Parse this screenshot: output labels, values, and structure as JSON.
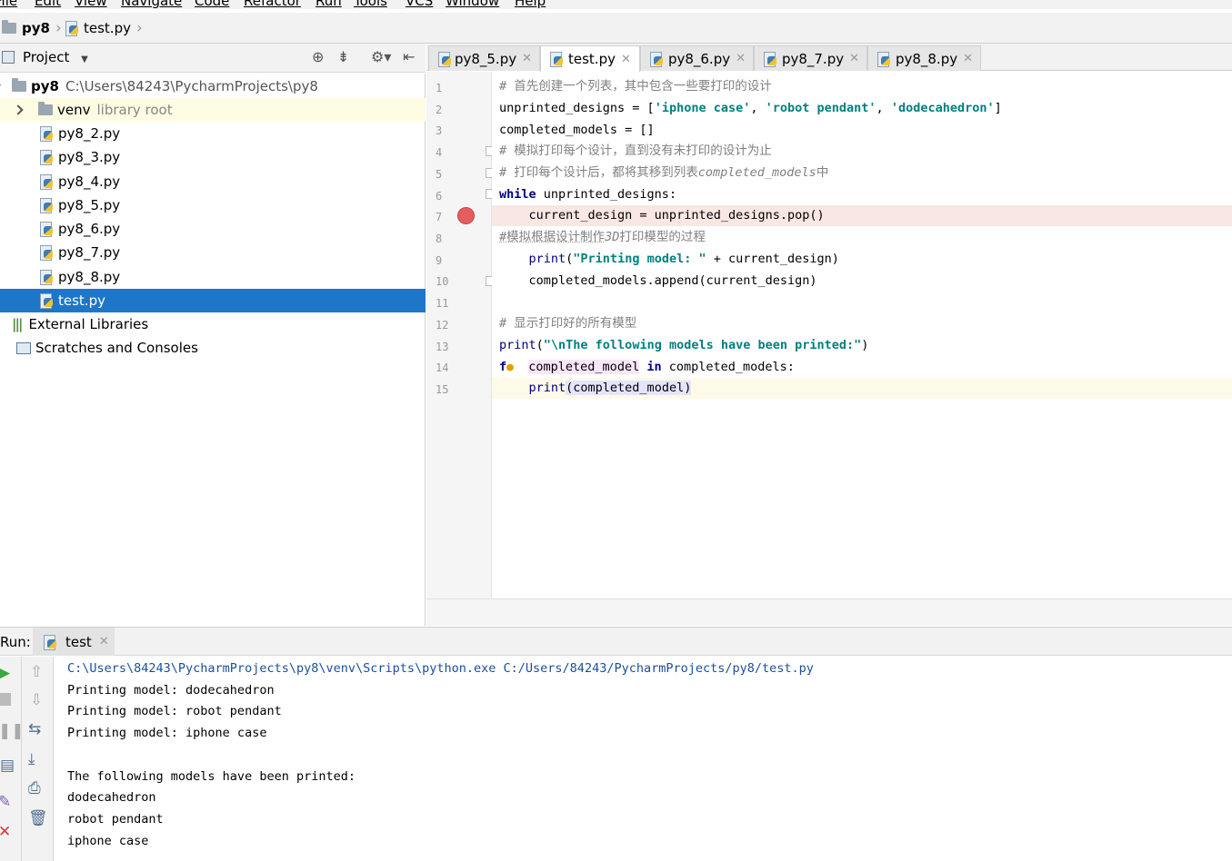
{
  "menu": [
    "File",
    "Edit",
    "View",
    "Navigate",
    "Code",
    "Refactor",
    "Run",
    "Tools",
    "VCS",
    "Window",
    "Help"
  ],
  "breadcrumb": {
    "project": "py8",
    "file": "test.py"
  },
  "project_panel": {
    "title": "Project",
    "root": {
      "name": "py8",
      "path": "C:\\Users\\84243\\PycharmProjects\\py8"
    },
    "venv": {
      "name": "venv",
      "note": "library root"
    },
    "files": [
      "py8_2.py",
      "py8_3.py",
      "py8_4.py",
      "py8_5.py",
      "py8_6.py",
      "py8_7.py",
      "py8_8.py",
      "test.py"
    ],
    "selected": "test.py",
    "external": "External Libraries",
    "scratches": "Scratches and Consoles"
  },
  "tabs": [
    {
      "label": "py8_5.py",
      "active": false
    },
    {
      "label": "test.py",
      "active": true
    },
    {
      "label": "py8_6.py",
      "active": false
    },
    {
      "label": "py8_7.py",
      "active": false
    },
    {
      "label": "py8_8.py",
      "active": false
    }
  ],
  "editor": {
    "line_numbers": [
      "1",
      "2",
      "3",
      "4",
      "5",
      "6",
      "7",
      "8",
      "9",
      "10",
      "11",
      "12",
      "13",
      "14",
      "15"
    ],
    "breakpoint_line": 7,
    "current_line": 15,
    "code": {
      "l1": "# 首先创建一个列表，其中包含一些要打印的设计",
      "l2a": "unprinted_designs = [",
      "l2b": "'iphone case'",
      "l2c": ", ",
      "l2d": "'robot pendant'",
      "l2e": ", ",
      "l2f": "'dodecahedron'",
      "l2g": "]",
      "l3": "completed_models = []",
      "l4": "# 模拟打印每个设计，直到没有未打印的设计为止",
      "l5a": "# 打印每个设计后，都将其移到列表",
      "l5b": "completed_models",
      "l5c": "中",
      "l6a": "while",
      "l6b": " unprinted_designs:",
      "l7": "    current_design = unprinted_designs.pop()",
      "l8a": "#模拟根据设计制作",
      "l8b": "3D",
      "l8c": "打印模型的过程",
      "l9a": "    ",
      "l9b": "print",
      "l9c": "(",
      "l9d": "\"Printing model: \"",
      "l9e": " + current_design)",
      "l10": "    completed_models.append(current_design)",
      "l12": "# 显示打印好的所有模型",
      "l13a": "print",
      "l13b": "(",
      "l13c": "\"\\nThe following models have been printed:\"",
      "l13d": ")",
      "l14a": "f",
      "l14b": "completed_model",
      "l14c": "in",
      "l14d": " completed_models:",
      "l15a": "    ",
      "l15b": "print",
      "l15c": "(completed_model)"
    }
  },
  "run": {
    "label": "Run:",
    "tab": "test",
    "output": [
      "C:\\Users\\84243\\PycharmProjects\\py8\\venv\\Scripts\\python.exe C:/Users/84243/PycharmProjects/py8/test.py",
      "Printing model: dodecahedron",
      "Printing model: robot pendant",
      "Printing model: iphone case",
      "",
      "The following models have been printed:",
      "dodecahedron",
      "robot pendant",
      "iphone case"
    ]
  },
  "colors": {
    "selection": "#1d76c8",
    "breakpoint": "#e55d5d",
    "keyword": "#000080",
    "string": "#008080"
  },
  "icons": [
    "folder-icon",
    "python-file-icon",
    "crosshair-icon",
    "collapse-icon",
    "gear-icon",
    "hide-icon",
    "breakpoint-icon",
    "run-icon",
    "stop-icon",
    "pause-icon",
    "up-arrow-icon",
    "down-arrow-icon",
    "wrap-icon",
    "scroll-end-icon",
    "print-icon",
    "trash-icon",
    "close-icon",
    "lightbulb-icon"
  ]
}
